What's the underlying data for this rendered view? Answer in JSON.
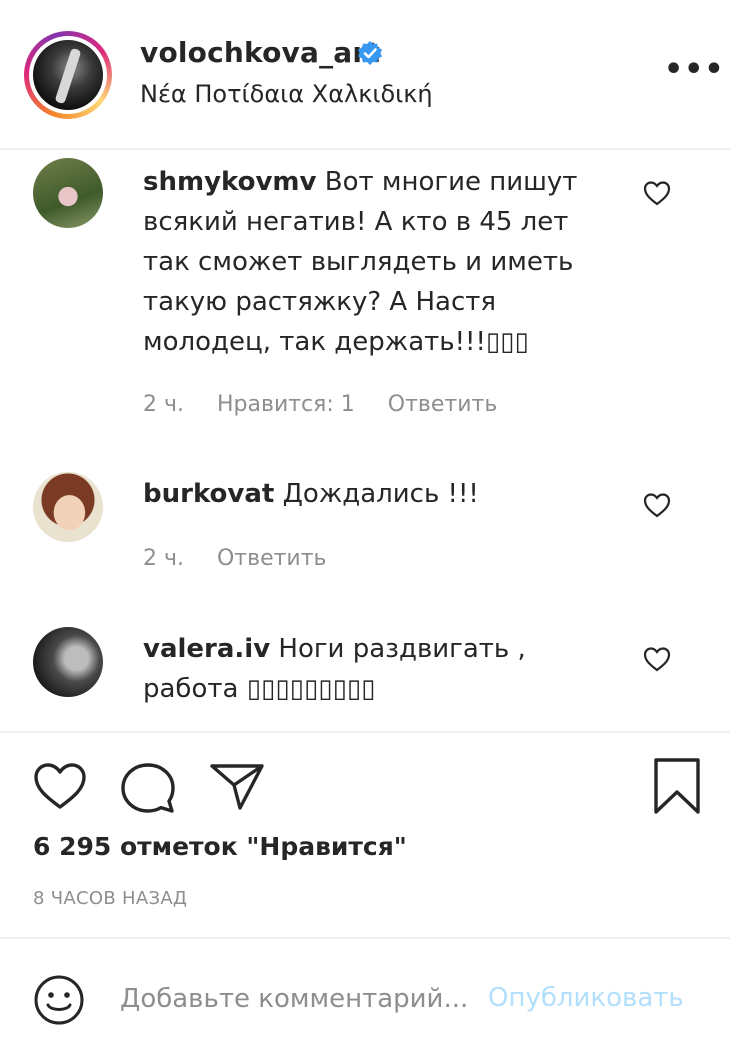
{
  "header": {
    "username": "volochkova_art",
    "location": "Νέα Ποτίδαια Χαλκιδική",
    "more_glyph": "•••",
    "verified_color": "#3897f0"
  },
  "comments": [
    {
      "username": "shmykovmv",
      "text": "Вот многие пишут всякий негатив! А кто в 45 лет так сможет выглядеть и иметь такую растяжку? А Настя молодец, так держать!!!▯▯▯",
      "time": "2 ч.",
      "likes": "Нравится: 1",
      "reply": "Ответить"
    },
    {
      "username": "burkovat",
      "text": "Дождались !!!",
      "time": "2 ч.",
      "reply": "Ответить"
    },
    {
      "username": "valera.iv",
      "text": "Ноги раздвигать , работа ▯▯▯▯▯▯▯▯▯"
    }
  ],
  "actions": {
    "like_icon": "heart-icon",
    "comment_icon": "comment-bubble-icon",
    "share_icon": "paper-plane-icon",
    "save_icon": "bookmark-icon"
  },
  "likes_text": "6 295 отметок \"Нравится\"",
  "posted_time": "8 ЧАСОВ НАЗАД",
  "add_comment": {
    "placeholder": "Добавьте комментарий...",
    "publish_label": "Опубликовать",
    "publish_color": "#b2dffc"
  }
}
